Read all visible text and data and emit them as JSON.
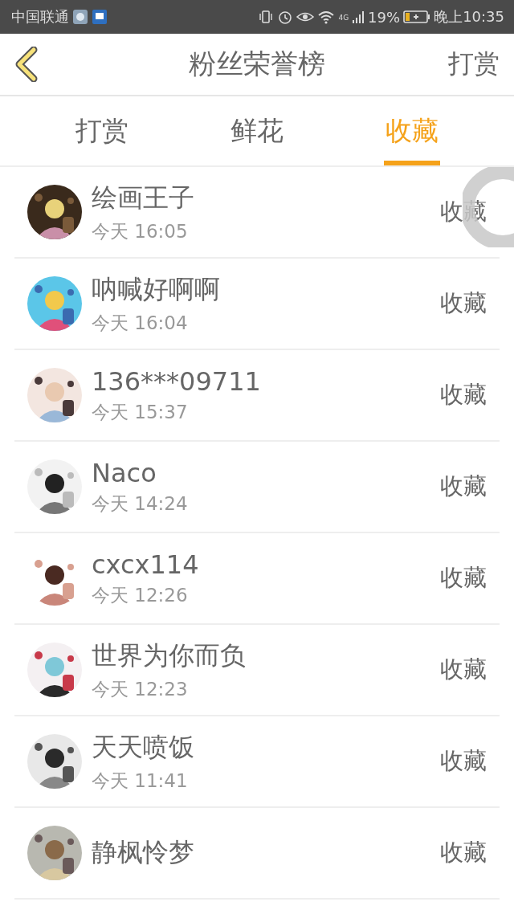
{
  "status_bar": {
    "carrier": "中国联通",
    "network": "4G",
    "battery": "19%",
    "time": "晚上10:35"
  },
  "nav": {
    "title": "粉丝荣誉榜",
    "action": "打赏"
  },
  "tabs": [
    {
      "label": "打赏",
      "selected": false
    },
    {
      "label": "鲜花",
      "selected": false
    },
    {
      "label": "收藏",
      "selected": true
    }
  ],
  "fans": [
    {
      "name": "绘画王子",
      "time": "今天 16:05",
      "action": "收藏"
    },
    {
      "name": "呐喊好啊啊",
      "time": "今天 16:04",
      "action": "收藏"
    },
    {
      "name": "136***09711",
      "time": "今天 15:37",
      "action": "收藏"
    },
    {
      "name": "Naco",
      "time": "今天 14:24",
      "action": "收藏"
    },
    {
      "name": "cxcx114",
      "time": "今天 12:26",
      "action": "收藏"
    },
    {
      "name": "世界为你而负",
      "time": "今天 12:23",
      "action": "收藏"
    },
    {
      "name": "天天喷饭",
      "time": "今天 11:41",
      "action": "收藏"
    },
    {
      "name": "静枫怜梦",
      "action": "收藏"
    }
  ]
}
